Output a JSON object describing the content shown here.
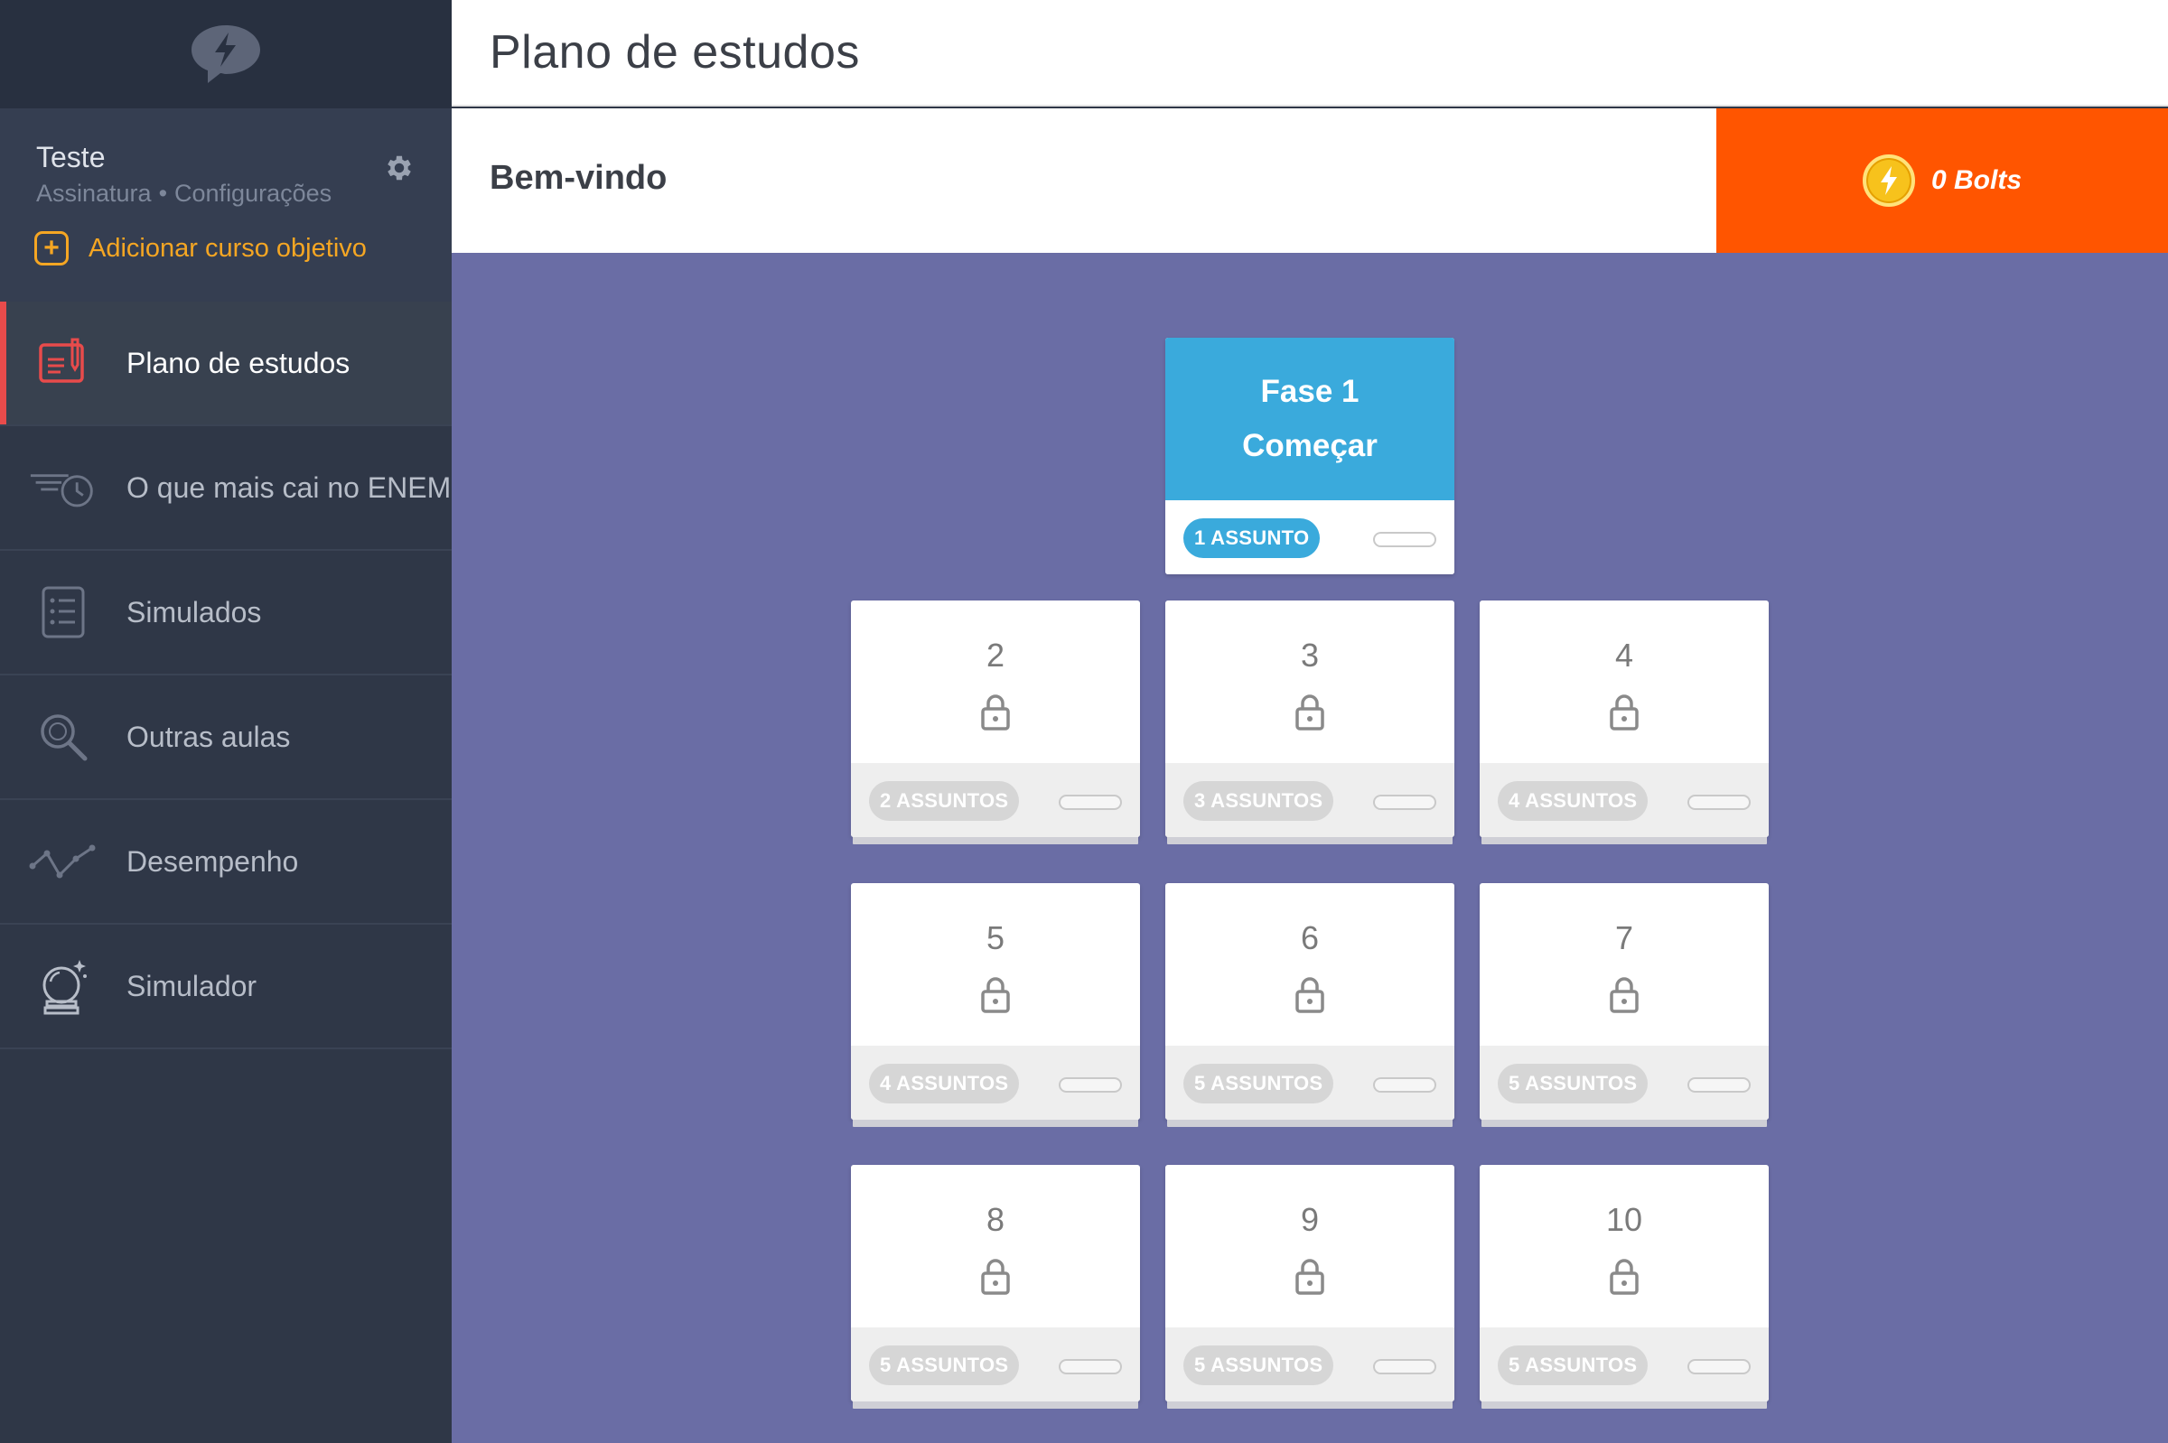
{
  "page": {
    "title": "Plano de estudos",
    "welcome": "Bem-vindo"
  },
  "user": {
    "name": "Teste",
    "subscription_link": "Assinatura",
    "separator": "•",
    "settings_link": "Configurações",
    "add_course": "Adicionar curso objetivo"
  },
  "nav": {
    "items": [
      {
        "label": "Plano de estudos",
        "icon": "study-plan-icon",
        "active": true
      },
      {
        "label": "O que mais cai no ENEM",
        "icon": "speed-clock-icon",
        "active": false
      },
      {
        "label": "Simulados",
        "icon": "checklist-icon",
        "active": false
      },
      {
        "label": "Outras aulas",
        "icon": "magnifier-icon",
        "active": false
      },
      {
        "label": "Desempenho",
        "icon": "line-graph-icon",
        "active": false
      },
      {
        "label": "Simulador",
        "icon": "crystal-ball-icon",
        "active": false
      }
    ]
  },
  "bolts": {
    "label": "0 Bolts",
    "count": 0
  },
  "phases": [
    {
      "title": "Fase 1",
      "action": "Começar",
      "subjects": "1 ASSUNTO",
      "locked": false,
      "progress": 0
    },
    {
      "number": "2",
      "subjects": "2 ASSUNTOS",
      "locked": true,
      "progress": 0
    },
    {
      "number": "3",
      "subjects": "3 ASSUNTOS",
      "locked": true,
      "progress": 0
    },
    {
      "number": "4",
      "subjects": "4 ASSUNTOS",
      "locked": true,
      "progress": 0
    },
    {
      "number": "5",
      "subjects": "4 ASSUNTOS",
      "locked": true,
      "progress": 0
    },
    {
      "number": "6",
      "subjects": "5 ASSUNTOS",
      "locked": true,
      "progress": 0
    },
    {
      "number": "7",
      "subjects": "5 ASSUNTOS",
      "locked": true,
      "progress": 0
    },
    {
      "number": "8",
      "subjects": "5 ASSUNTOS",
      "locked": true,
      "progress": 0
    },
    {
      "number": "9",
      "subjects": "5 ASSUNTOS",
      "locked": true,
      "progress": 0
    },
    {
      "number": "10",
      "subjects": "5 ASSUNTOS",
      "locked": true,
      "progress": 0
    }
  ],
  "colors": {
    "accent_orange": "#ff5500",
    "phase_blue": "#3aaadc",
    "active_red": "#e84b4b",
    "course_orange": "#f5a623",
    "main_bg": "#6a6da5",
    "sidebar_bg": "#2f3747"
  }
}
